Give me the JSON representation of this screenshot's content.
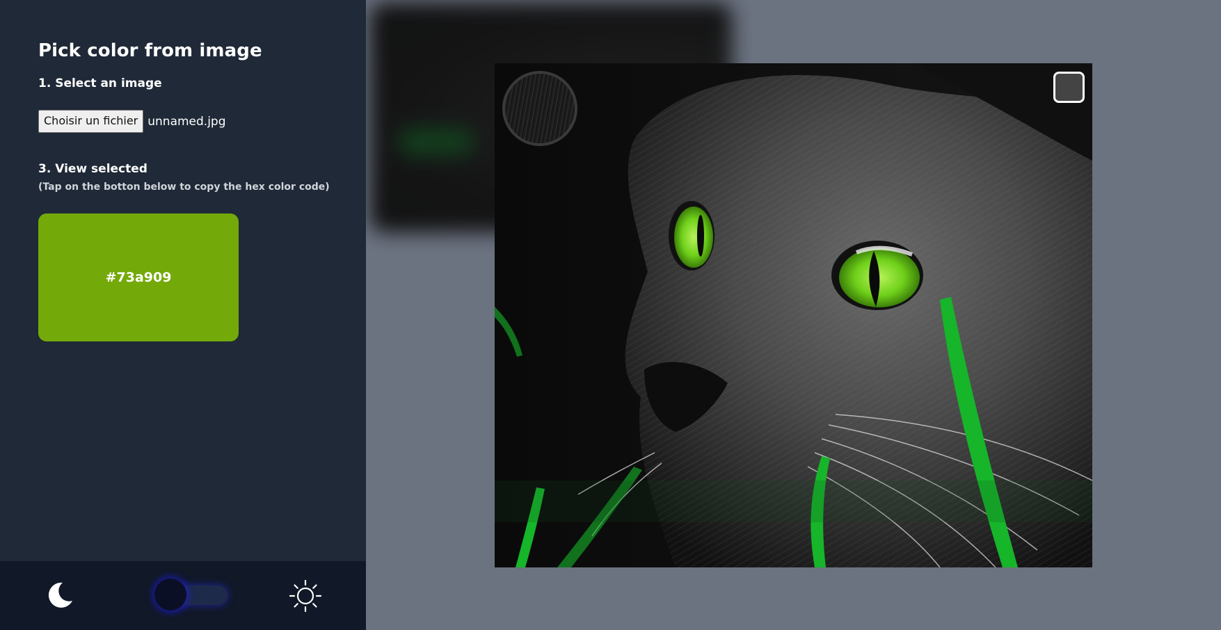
{
  "sidebar": {
    "title": "Pick color from image",
    "step1_label": "1. Select an image",
    "file_button_label": "Choisir un fichier",
    "file_name": "unnamed.jpg",
    "step3_label": "3. View selected",
    "step3_hint": "(Tap on the botton below to copy the hex color code)",
    "selected_hex": "#73a909",
    "selected_color": "#73a909"
  },
  "theme_bar": {
    "dark_icon": "moon-icon",
    "light_icon": "sun-icon",
    "toggle_state": "dark"
  },
  "preview": {
    "image_subject": "cat-photo",
    "hover_color": "#444444"
  },
  "colors": {
    "sidebar_bg": "#1f2937",
    "theme_bar_bg": "#111827",
    "main_bg": "#6b7280"
  }
}
